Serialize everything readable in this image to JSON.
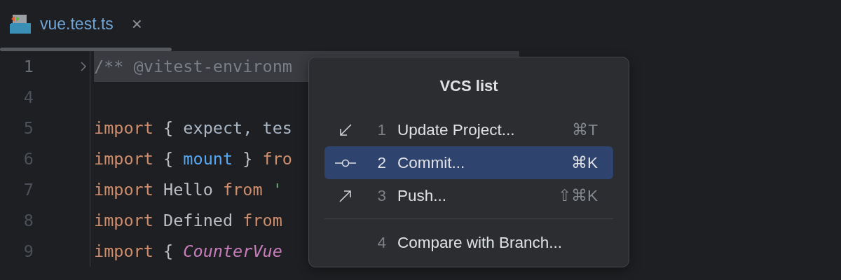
{
  "tabs": [
    {
      "label": "vue.test.ts",
      "selected": true,
      "close": "×"
    }
  ],
  "editor": {
    "lines": [
      {
        "number": "1",
        "folded": true,
        "highlighted": true,
        "tokens": [
          {
            "kind": "comment",
            "text": "/** @vitest-environm"
          }
        ]
      },
      {
        "number": "4",
        "folded": false,
        "highlighted": false
      },
      {
        "number": "5",
        "folded": false,
        "highlighted": false,
        "tokens": [
          {
            "kind": "keyword",
            "text": "import"
          },
          {
            "kind": "plain",
            "text": " { "
          },
          {
            "kind": "name",
            "text": "expect, tes"
          }
        ]
      },
      {
        "number": "6",
        "folded": false,
        "highlighted": false,
        "tokens": [
          {
            "kind": "keyword",
            "text": "import"
          },
          {
            "kind": "plain",
            "text": " { "
          },
          {
            "kind": "function",
            "text": "mount"
          },
          {
            "kind": "plain",
            "text": " } "
          },
          {
            "kind": "keyword",
            "text": "fro"
          }
        ]
      },
      {
        "number": "7",
        "folded": false,
        "highlighted": false,
        "tokens": [
          {
            "kind": "keyword",
            "text": "import"
          },
          {
            "kind": "plain",
            "text": " Hello "
          },
          {
            "kind": "keyword",
            "text": "from"
          },
          {
            "kind": "string",
            "text": " '"
          }
        ]
      },
      {
        "number": "8",
        "folded": false,
        "highlighted": false,
        "tokens": [
          {
            "kind": "keyword",
            "text": "import"
          },
          {
            "kind": "plain",
            "text": " Defined "
          },
          {
            "kind": "keyword",
            "text": "from"
          }
        ]
      },
      {
        "number": "9",
        "folded": false,
        "highlighted": false,
        "tokens": [
          {
            "kind": "keyword",
            "text": "import"
          },
          {
            "kind": "plain",
            "text": " { "
          },
          {
            "kind": "type",
            "text": "CounterVue"
          }
        ]
      }
    ]
  },
  "popup": {
    "title": "VCS list",
    "sections": [
      [
        {
          "kind": "update",
          "number": "1",
          "label": "Update Project...",
          "shortcut": "⌘T",
          "selected": false
        },
        {
          "kind": "commit",
          "number": "2",
          "label": "Commit...",
          "shortcut": "⌘K",
          "selected": true
        },
        {
          "kind": "push",
          "number": "3",
          "label": "Push...",
          "shortcut": "⇧⌘K",
          "selected": false
        }
      ],
      [
        {
          "kind": "compare",
          "number": "4",
          "label": "Compare with Branch...",
          "selected": false
        }
      ]
    ]
  }
}
